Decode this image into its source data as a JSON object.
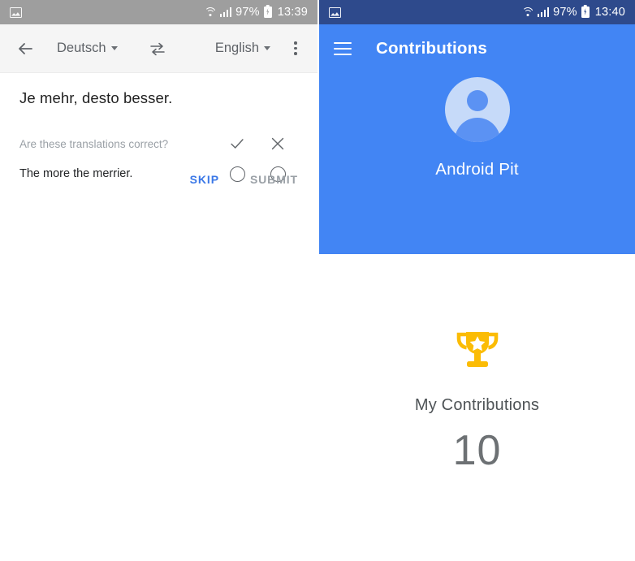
{
  "left_panel": {
    "status_bar": {
      "image_icon": "image-icon",
      "wifi_icon": "wifi-icon",
      "signal_icon": "signal-bars-icon",
      "battery_icon": "battery-charging-icon",
      "battery_percent": "97%",
      "clock": "13:39"
    },
    "toolbar": {
      "back_icon": "back-arrow-icon",
      "source_language": "Deutsch",
      "swap_icon": "swap-languages-icon",
      "target_language": "English",
      "overflow_icon": "overflow-menu-icon"
    },
    "content": {
      "source_phrase": "Je mehr, desto besser.",
      "question_label": "Are these translations correct?",
      "target_phrase": "The more the merrier.",
      "approve_icon": "check-icon",
      "reject_icon": "close-x-icon",
      "approve_radio": "radio-approve",
      "reject_radio": "radio-reject"
    },
    "actions": {
      "skip_label": "SKIP",
      "submit_label": "SUBMIT",
      "skip_color": "#3b78e7",
      "submit_color": "#9aa0a6"
    }
  },
  "right_panel": {
    "status_bar": {
      "image_icon": "image-icon",
      "wifi_icon": "wifi-icon",
      "signal_icon": "signal-bars-icon",
      "battery_icon": "battery-charging-icon",
      "battery_percent": "97%",
      "clock": "13:40"
    },
    "app_bar": {
      "menu_icon": "hamburger-menu-icon",
      "title": "Contributions",
      "background_color": "#4285f4"
    },
    "profile": {
      "avatar_icon": "user-avatar-icon",
      "name": "Android Pit"
    },
    "contributions": {
      "trophy_icon": "trophy-icon",
      "trophy_color": "#fbbc05",
      "label": "My Contributions",
      "count": "10"
    }
  }
}
